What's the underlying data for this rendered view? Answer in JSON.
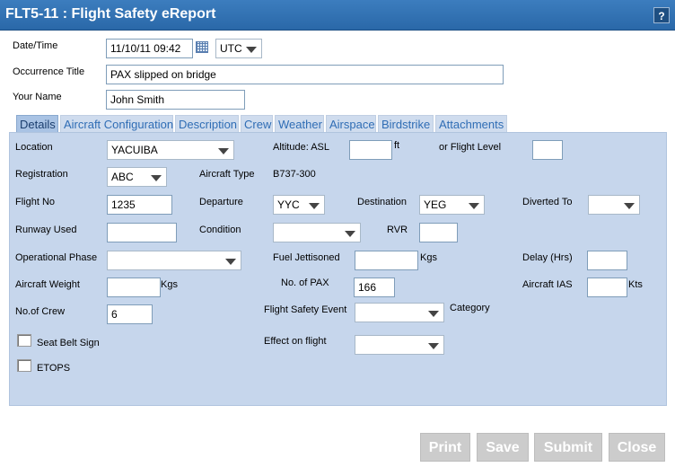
{
  "window": {
    "title": "FLT5-11 : Flight Safety eReport",
    "help_label": "?"
  },
  "header": {
    "datetime_label": "Date/Time",
    "datetime_value": "11/10/11 09:42",
    "timezone_value": "UTC",
    "occurrence_title_label": "Occurrence Title",
    "occurrence_title_value": "PAX slipped on bridge",
    "your_name_label": "Your Name",
    "your_name_value": "John Smith"
  },
  "tabs": [
    {
      "label": "Details"
    },
    {
      "label": "Aircraft Configuration"
    },
    {
      "label": "Description"
    },
    {
      "label": "Crew"
    },
    {
      "label": "Weather"
    },
    {
      "label": "Airspace"
    },
    {
      "label": "Birdstrike"
    },
    {
      "label": "Attachments"
    }
  ],
  "details": {
    "location_label": "Location",
    "location_value": "YACUIBA",
    "altitude_label": "Altitude: ASL",
    "altitude_value": "",
    "altitude_unit": "ft",
    "flight_level_label": "or Flight Level",
    "flight_level_value": "",
    "registration_label": "Registration",
    "registration_value": "ABC",
    "aircraft_type_label": "Aircraft Type",
    "aircraft_type_value": "B737-300",
    "flight_no_label": "Flight No",
    "flight_no_value": "1235",
    "departure_label": "Departure",
    "departure_value": "YYC",
    "destination_label": "Destination",
    "destination_value": "YEG",
    "diverted_to_label": "Diverted To",
    "diverted_to_value": "",
    "runway_used_label": "Runway Used",
    "runway_used_value": "",
    "condition_label": "Condition",
    "condition_value": "",
    "rvr_label": "RVR",
    "rvr_value": "",
    "operational_phase_label": "Operational Phase",
    "operational_phase_value": "",
    "fuel_jettisoned_label": "Fuel Jettisoned",
    "fuel_jettisoned_value": "",
    "fuel_unit": "Kgs",
    "delay_label": "Delay (Hrs)",
    "delay_value": "",
    "aircraft_weight_label": "Aircraft Weight",
    "aircraft_weight_value": "",
    "weight_unit": "Kgs",
    "no_of_pax_label": "No. of PAX",
    "no_of_pax_value": "166",
    "aircraft_ias_label": "Aircraft IAS",
    "aircraft_ias_value": "",
    "ias_unit": "Kts",
    "no_of_crew_label": "No.of Crew",
    "no_of_crew_value": "6",
    "flight_safety_event_label": "Flight Safety Event",
    "flight_safety_event_value": "",
    "category_label": "Category",
    "seat_belt_sign_label": "Seat Belt Sign",
    "effect_on_flight_label": "Effect on flight",
    "effect_on_flight_value": "",
    "etops_label": "ETOPS"
  },
  "footer": {
    "print_label": "Print",
    "save_label": "Save",
    "submit_label": "Submit",
    "close_label": "Close"
  }
}
